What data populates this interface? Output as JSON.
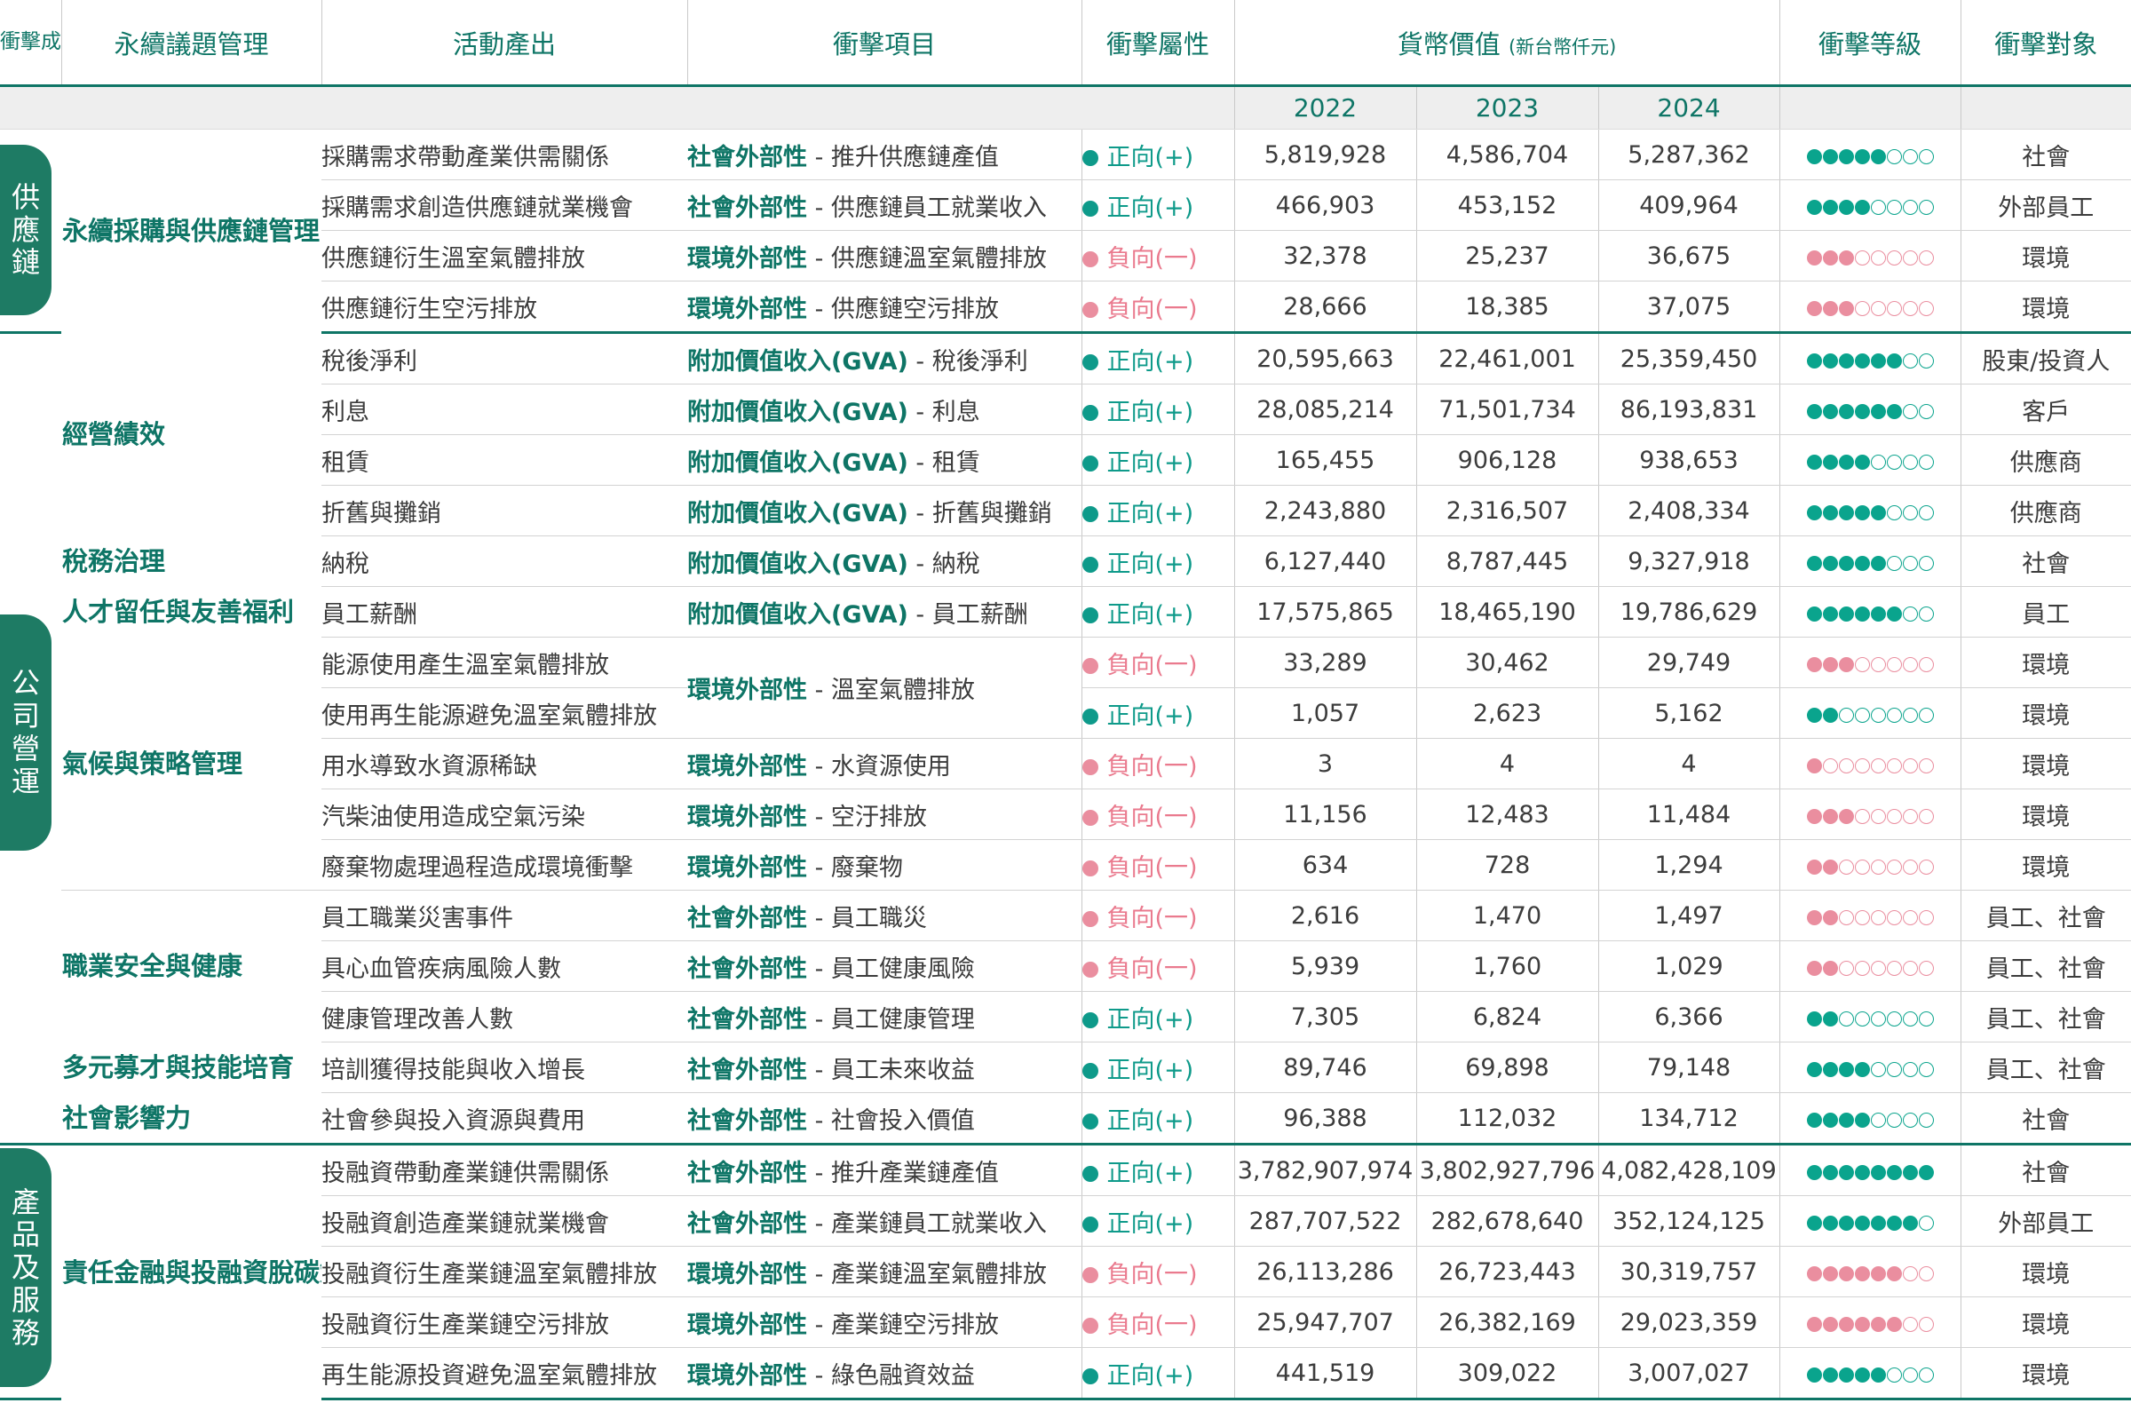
{
  "headers": {
    "cause": "衝擊成因",
    "issue": "永續議題管理",
    "output": "活動產出",
    "item": "衝擊項目",
    "nature": "衝擊屬性",
    "value": "貨幣價值",
    "value_unit": "(新台幣仟元)",
    "level": "衝擊等級",
    "target": "衝擊對象",
    "years": [
      "2022",
      "2023",
      "2024"
    ]
  },
  "categories": [
    {
      "chars": [
        "供",
        "應",
        "鏈"
      ]
    },
    {
      "chars": [
        "公",
        "司",
        "營",
        "運"
      ]
    },
    {
      "chars": [
        "產",
        "品",
        "及",
        "服",
        "務"
      ]
    }
  ],
  "issues": [
    "永續採購與供應鏈管理",
    "經營績效",
    "稅務治理",
    "人才留任與友善福利",
    "氣候與策略管理",
    "職業安全與健康",
    "多元募才與技能培育",
    "社會影響力",
    "責任金融與投融資脫碳策略"
  ],
  "impact_types": {
    "pos": "正向(+)",
    "neg": "負向(一)"
  },
  "rows": [
    {
      "output": "採購需求帶動產業供需關係",
      "ext": "社會外部性",
      "item": " - 推升供應鏈產值",
      "nature": "pos",
      "v2022": "5,819,928",
      "v2023": "4,586,704",
      "v2024": "5,287,362",
      "level": 5,
      "target": "社會"
    },
    {
      "output": "採購需求創造供應鏈就業機會",
      "ext": "社會外部性",
      "item": " - 供應鏈員工就業收入",
      "nature": "pos",
      "v2022": "466,903",
      "v2023": "453,152",
      "v2024": "409,964",
      "level": 4,
      "target": "外部員工"
    },
    {
      "output": "供應鏈衍生溫室氣體排放",
      "ext": "環境外部性",
      "item": " - 供應鏈溫室氣體排放",
      "nature": "neg",
      "v2022": "32,378",
      "v2023": "25,237",
      "v2024": "36,675",
      "level": 3,
      "target": "環境"
    },
    {
      "output": "供應鏈衍生空污排放",
      "ext": "環境外部性",
      "item": " - 供應鏈空污排放",
      "nature": "neg",
      "v2022": "28,666",
      "v2023": "18,385",
      "v2024": "37,075",
      "level": 3,
      "target": "環境"
    },
    {
      "output": "稅後淨利",
      "ext": "附加價值收入(GVA)",
      "item": " - 稅後淨利",
      "nature": "pos",
      "v2022": "20,595,663",
      "v2023": "22,461,001",
      "v2024": "25,359,450",
      "level": 6,
      "target": "股東/投資人"
    },
    {
      "output": "利息",
      "ext": "附加價值收入(GVA)",
      "item": " - 利息",
      "nature": "pos",
      "v2022": "28,085,214",
      "v2023": "71,501,734",
      "v2024": "86,193,831",
      "level": 6,
      "target": "客戶"
    },
    {
      "output": "租賃",
      "ext": "附加價值收入(GVA)",
      "item": " - 租賃",
      "nature": "pos",
      "v2022": "165,455",
      "v2023": "906,128",
      "v2024": "938,653",
      "level": 4,
      "target": "供應商"
    },
    {
      "output": "折舊與攤銷",
      "ext": "附加價值收入(GVA)",
      "item": " - 折舊與攤銷",
      "nature": "pos",
      "v2022": "2,243,880",
      "v2023": "2,316,507",
      "v2024": "2,408,334",
      "level": 5,
      "target": "供應商"
    },
    {
      "output": "納稅",
      "ext": "附加價值收入(GVA)",
      "item": " - 納稅",
      "nature": "pos",
      "v2022": "6,127,440",
      "v2023": "8,787,445",
      "v2024": "9,327,918",
      "level": 5,
      "target": "社會"
    },
    {
      "output": "員工薪酬",
      "ext": "附加價值收入(GVA)",
      "item": " - 員工薪酬",
      "nature": "pos",
      "v2022": "17,575,865",
      "v2023": "18,465,190",
      "v2024": "19,786,629",
      "level": 6,
      "target": "員工"
    },
    {
      "output": "能源使用產生溫室氣體排放",
      "ext": "環境外部性",
      "item": " - 溫室氣體排放",
      "nature": "neg",
      "v2022": "33,289",
      "v2023": "30,462",
      "v2024": "29,749",
      "level": 3,
      "target": "環境"
    },
    {
      "output": "使用再生能源避免溫室氣體排放",
      "ext": "",
      "item": "",
      "nature": "pos",
      "v2022": "1,057",
      "v2023": "2,623",
      "v2024": "5,162",
      "level": 2,
      "target": "環境"
    },
    {
      "output": "用水導致水資源稀缺",
      "ext": "環境外部性",
      "item": " - 水資源使用",
      "nature": "neg",
      "v2022": "3",
      "v2023": "4",
      "v2024": "4",
      "level": 1,
      "target": "環境"
    },
    {
      "output": "汽柴油使用造成空氣污染",
      "ext": "環境外部性",
      "item": " - 空汙排放",
      "nature": "neg",
      "v2022": "11,156",
      "v2023": "12,483",
      "v2024": "11,484",
      "level": 3,
      "target": "環境"
    },
    {
      "output": "廢棄物處理過程造成環境衝擊",
      "ext": "環境外部性",
      "item": " - 廢棄物",
      "nature": "neg",
      "v2022": "634",
      "v2023": "728",
      "v2024": "1,294",
      "level": 2,
      "target": "環境"
    },
    {
      "output": "員工職業災害事件",
      "ext": "社會外部性",
      "item": " - 員工職災",
      "nature": "neg",
      "v2022": "2,616",
      "v2023": "1,470",
      "v2024": "1,497",
      "level": 2,
      "target": "員工、社會"
    },
    {
      "output": "具心血管疾病風險人數",
      "ext": "社會外部性",
      "item": " - 員工健康風險",
      "nature": "neg",
      "v2022": "5,939",
      "v2023": "1,760",
      "v2024": "1,029",
      "level": 2,
      "target": "員工、社會"
    },
    {
      "output": "健康管理改善人數",
      "ext": "社會外部性",
      "item": " - 員工健康管理",
      "nature": "pos",
      "v2022": "7,305",
      "v2023": "6,824",
      "v2024": "6,366",
      "level": 2,
      "target": "員工、社會"
    },
    {
      "output": "培訓獲得技能與收入增長",
      "ext": "社會外部性",
      "item": " - 員工未來收益",
      "nature": "pos",
      "v2022": "89,746",
      "v2023": "69,898",
      "v2024": "79,148",
      "level": 4,
      "target": "員工、社會"
    },
    {
      "output": "社會參與投入資源與費用",
      "ext": "社會外部性",
      "item": " - 社會投入價值",
      "nature": "pos",
      "v2022": "96,388",
      "v2023": "112,032",
      "v2024": "134,712",
      "level": 4,
      "target": "社會"
    },
    {
      "output": "投融資帶動產業鏈供需關係",
      "ext": "社會外部性",
      "item": " - 推升產業鏈產值",
      "nature": "pos",
      "v2022": "3,782,907,974",
      "v2023": "3,802,927,796",
      "v2024": "4,082,428,109",
      "level": 8,
      "target": "社會"
    },
    {
      "output": "投融資創造產業鏈就業機會",
      "ext": "社會外部性",
      "item": " - 產業鏈員工就業收入",
      "nature": "pos",
      "v2022": "287,707,522",
      "v2023": "282,678,640",
      "v2024": "352,124,125",
      "level": 7,
      "target": "外部員工"
    },
    {
      "output": "投融資衍生產業鏈溫室氣體排放",
      "ext": "環境外部性",
      "item": " - 產業鏈溫室氣體排放",
      "nature": "neg",
      "v2022": "26,113,286",
      "v2023": "26,723,443",
      "v2024": "30,319,757",
      "level": 6,
      "target": "環境"
    },
    {
      "output": "投融資衍生產業鏈空污排放",
      "ext": "環境外部性",
      "item": " - 產業鏈空污排放",
      "nature": "neg",
      "v2022": "25,947,707",
      "v2023": "26,382,169",
      "v2024": "29,023,359",
      "level": 6,
      "target": "環境"
    },
    {
      "output": "再生能源投資避免溫室氣體排放",
      "ext": "環境外部性",
      "item": " - 綠色融資效益",
      "nature": "pos",
      "v2022": "441,519",
      "v2023": "309,022",
      "v2024": "3,007,027",
      "level": 5,
      "target": "環境"
    }
  ]
}
